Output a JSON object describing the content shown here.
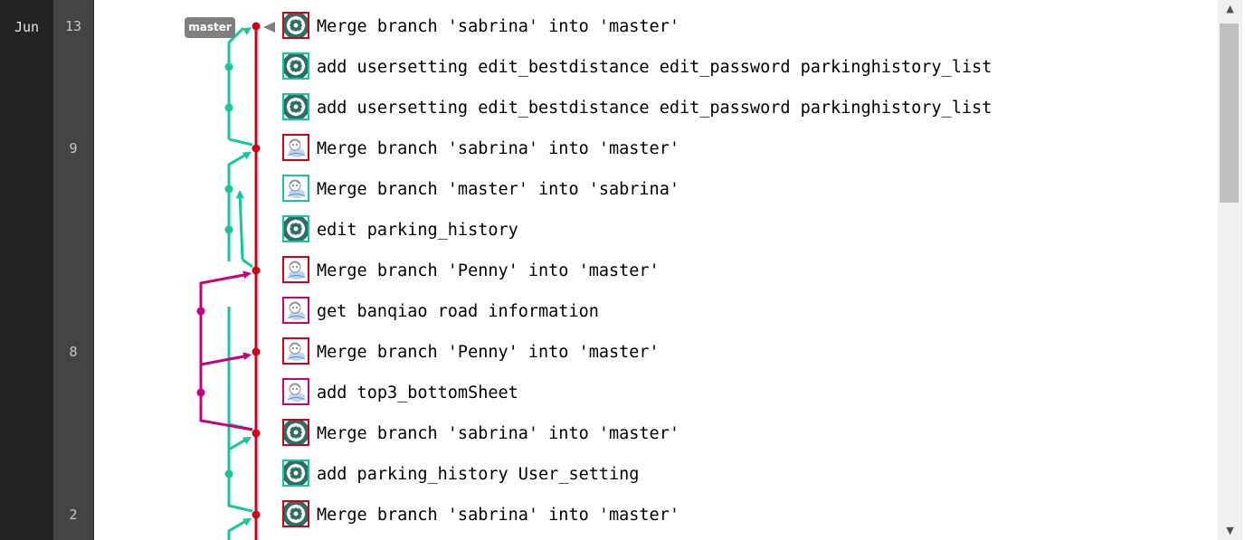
{
  "month": "Jun",
  "days": [
    {
      "row": 0,
      "label": "13"
    },
    {
      "row": 3,
      "label": "9"
    },
    {
      "row": 8,
      "label": "8"
    },
    {
      "row": 12,
      "label": "2"
    }
  ],
  "branch_tag": "master",
  "colors": {
    "master": "#d0021b",
    "sabrina": "#16c79a",
    "penny": "#c7007d"
  },
  "commits": [
    {
      "message": "Merge branch 'sabrina' into 'master'",
      "avatar": "pattern-avatar-icon",
      "border": "master"
    },
    {
      "message": "add usersetting edit_bestdistance edit_password parkinghistory_list",
      "avatar": "pattern-avatar-icon",
      "border": "sabrina"
    },
    {
      "message": "add usersetting edit_bestdistance edit_password parkinghistory_list",
      "avatar": "pattern-avatar-icon",
      "border": "sabrina"
    },
    {
      "message": "Merge branch 'sabrina' into 'master'",
      "avatar": "cartoon-avatar-icon",
      "border": "master"
    },
    {
      "message": "Merge branch 'master' into 'sabrina'",
      "avatar": "cartoon-avatar-icon",
      "border": "sabrina"
    },
    {
      "message": "edit parking_history",
      "avatar": "pattern-avatar-icon",
      "border": "sabrina"
    },
    {
      "message": "Merge branch 'Penny' into 'master'",
      "avatar": "cartoon-avatar-icon",
      "border": "master"
    },
    {
      "message": "get banqiao road information",
      "avatar": "cartoon-avatar-icon",
      "border": "penny"
    },
    {
      "message": "Merge branch 'Penny' into 'master'",
      "avatar": "cartoon-avatar-icon",
      "border": "master"
    },
    {
      "message": "add top3_bottomSheet",
      "avatar": "cartoon-avatar-icon",
      "border": "penny"
    },
    {
      "message": "Merge branch 'sabrina' into 'master'",
      "avatar": "pattern-avatar-icon",
      "border": "master"
    },
    {
      "message": "add parking_history User_setting",
      "avatar": "pattern-avatar-icon",
      "border": "sabrina"
    },
    {
      "message": "Merge branch 'sabrina' into 'master'",
      "avatar": "pattern-avatar-icon",
      "border": "master"
    }
  ],
  "scroll_up_glyph": "▲",
  "scroll_down_glyph": "▼"
}
